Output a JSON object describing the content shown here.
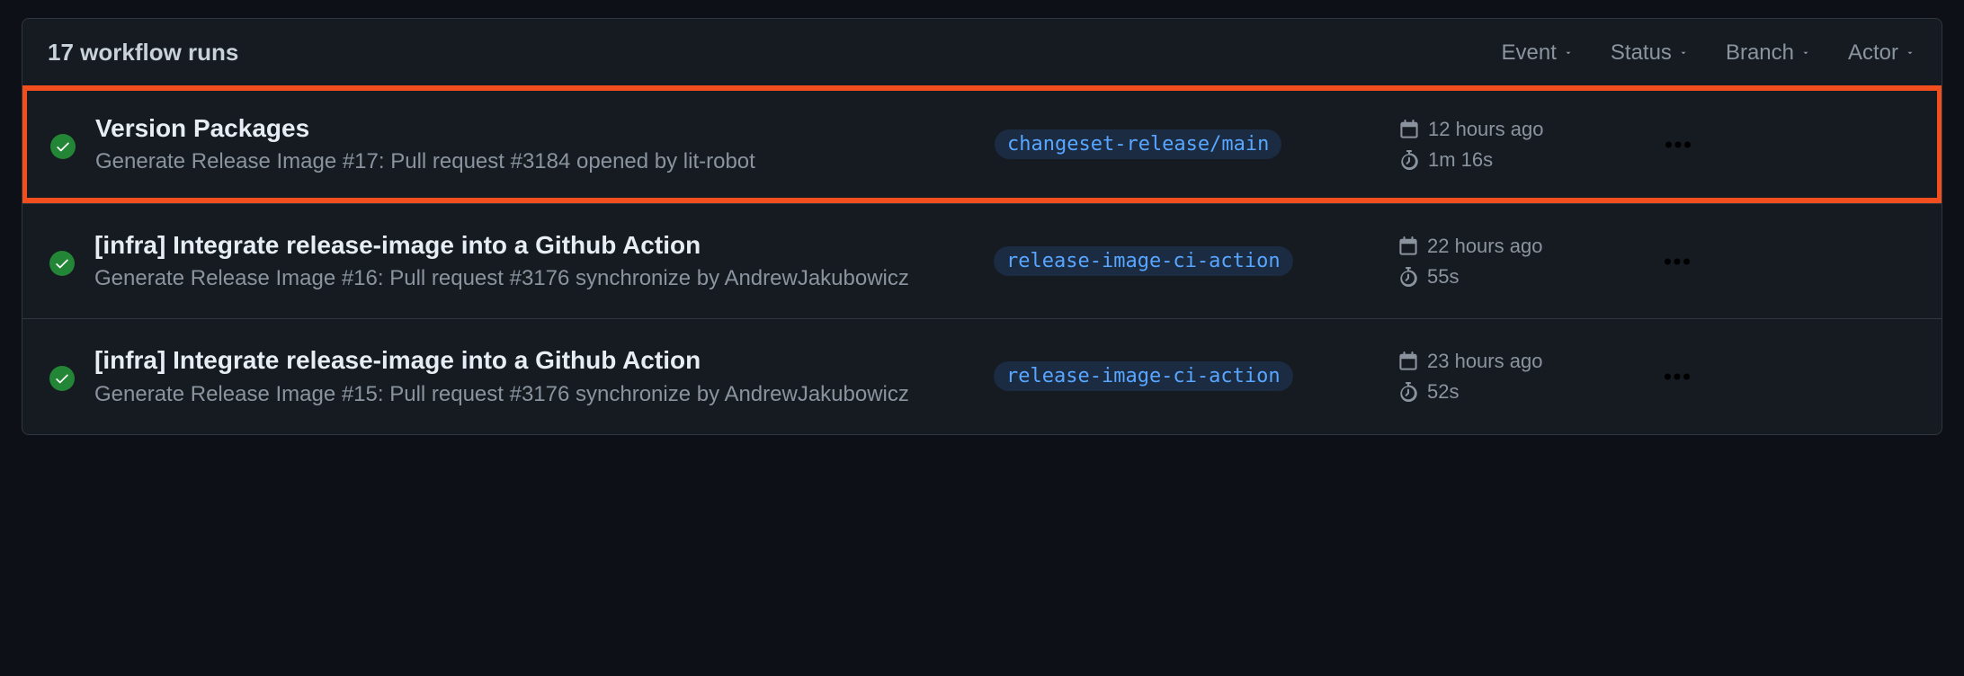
{
  "header": {
    "title": "17 workflow runs",
    "filters": {
      "event": "Event",
      "status": "Status",
      "branch": "Branch",
      "actor": "Actor"
    }
  },
  "runs": [
    {
      "highlighted": true,
      "status": "success",
      "title": "Version Packages",
      "subtitle": "Generate Release Image #17: Pull request #3184 opened by lit-robot",
      "branch": "changeset-release/main",
      "time_ago": "12 hours ago",
      "duration": "1m 16s"
    },
    {
      "highlighted": false,
      "status": "success",
      "title": "[infra] Integrate release-image into a Github Action",
      "subtitle": "Generate Release Image #16: Pull request #3176 synchronize by AndrewJakubowicz",
      "branch": "release-image-ci-action",
      "time_ago": "22 hours ago",
      "duration": "55s"
    },
    {
      "highlighted": false,
      "status": "success",
      "title": "[infra] Integrate release-image into a Github Action",
      "subtitle": "Generate Release Image #15: Pull request #3176 synchronize by AndrewJakubowicz",
      "branch": "release-image-ci-action",
      "time_ago": "23 hours ago",
      "duration": "52s"
    }
  ]
}
